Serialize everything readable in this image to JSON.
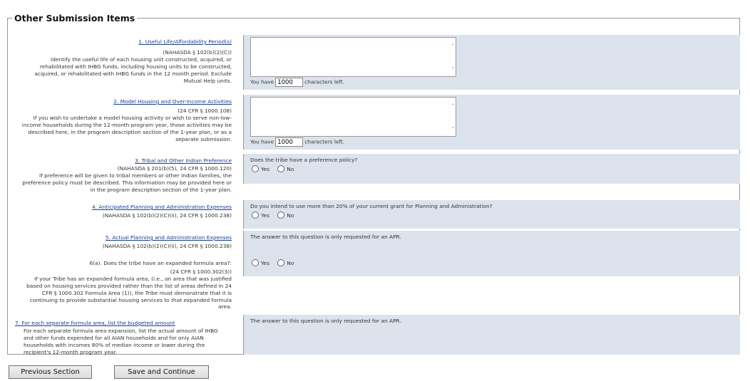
{
  "section_title": "Other Submission Items",
  "items": [
    {
      "title": "1. Useful Life/Affordability Period(s)",
      "citation": "(NAHASDA § 102(b)(2)(C))",
      "description": "Identify the useful life of each housing unit constructed, acquired, or rehabilitated with IHBG funds, including housing units to be constructed, acquired, or rehabilitated with IHBG funds in the 12 month period. Exclude Mutual Help units.",
      "chars_prefix": "You have",
      "chars_value": "1000",
      "chars_suffix": "characters left."
    },
    {
      "title": "2. Model Housing and Over-Income Activities",
      "citation": "(24 CFR § 1000.108)",
      "description": "If you wish to undertake a model housing activity or wish to serve non-low-income households during the 12-month program year, those activities may be described here, in the program description section of the 1-year plan, or as a separate submission.",
      "chars_prefix": "You have",
      "chars_value": "1000",
      "chars_suffix": "characters left."
    },
    {
      "title": "3. Tribal and Other Indian Preference",
      "citation": "(NAHASDA § 201(b)(5), 24 CFR § 1000.120)",
      "description": "If preference will be given to tribal members or other Indian families, the preference policy must be described. This information may be provided here or in the program description section of the 1-year plan.",
      "question": "Does the tribe have a preference policy?"
    },
    {
      "title": "4. Anticipated Planning and Administration Expenses",
      "citation": "(NAHASDA § 102(b)(2)(C)(ii), 24 CFR § 1000.238)",
      "question": "Do you intend to use more than 20% of your current grant for Planning and Administration?"
    },
    {
      "title": "5. Actual Planning and Administration Expenses",
      "citation": "(NAHASDA § 102(b)(2)(C)(ii), 24 CFR § 1000.238)",
      "answer_note": "The answer to this question is only requested for an APR."
    },
    {
      "title": "6(a). Does the tribe have an expanded formula area?:",
      "citation": "(24 CFR § 1000.302(3))",
      "description": "If your Tribe has an expanded formula area, (i.e., an area that was justified based on housing services provided rather than the list of areas defined in 24 CFR § 1000.302 Formula Area (1)), the Tribe must demonstrate that it is continuing to provide substantial housing services to that expanded formula area."
    },
    {
      "title": "7. For each separate formula area, list the budgeted amount",
      "description": "For each separate formula area expansion, list the actual amount of IHBG and other funds expended for all AIAN households and for only AIAN households with incomes 80% of median income or lower during the recipient's 12-month program year.",
      "answer_note": "The answer to this question is only requested for an APR."
    }
  ],
  "radio": {
    "yes": "Yes",
    "no": "No"
  },
  "buttons": {
    "previous": "Previous Section",
    "save": "Save and Continue"
  },
  "colors": {
    "answer_bg": "#dce3ec",
    "link": "#1a3d8f"
  },
  "icons": {
    "scroll_up": "chevron-up-icon",
    "scroll_down": "chevron-down-icon"
  }
}
